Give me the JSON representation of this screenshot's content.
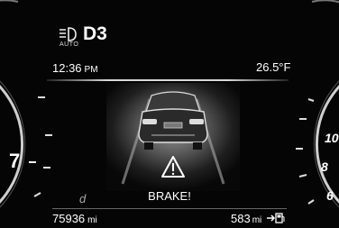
{
  "header": {
    "lights_label": "AUTO",
    "gear": "D3",
    "lights_icon": "headlight-icon"
  },
  "info": {
    "time": "12:36",
    "time_suffix": "PM",
    "temperature": "26.5°F"
  },
  "alert": {
    "message": "BRAKE!",
    "icon": "warning-triangle-icon"
  },
  "footer": {
    "odometer_value": "75936",
    "odometer_unit": "mi",
    "range_value": "583",
    "range_unit": "mi",
    "range_icon": "fuel-pump-icon",
    "trip_icon": "trip-icon"
  },
  "gauges": {
    "left_visible_value": "7",
    "right_visible_values": [
      "10",
      "8",
      "6"
    ]
  },
  "colors": {
    "background": "#050505",
    "text": "#ffffff"
  }
}
